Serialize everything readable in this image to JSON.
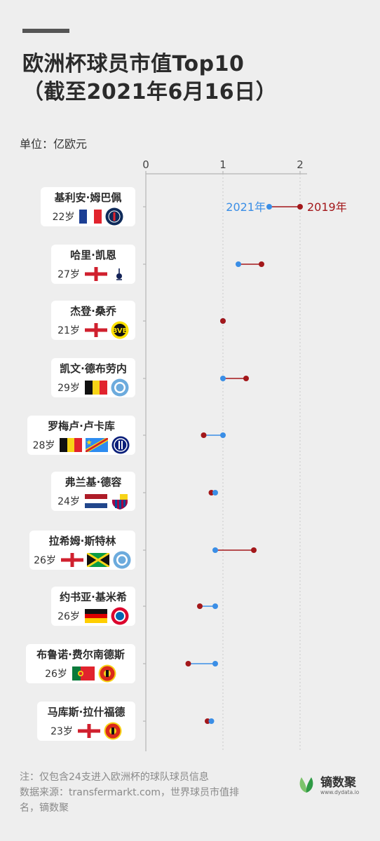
{
  "title_line1": "欧洲杯球员市值Top10",
  "title_line2": "（截至2021年6月16日）",
  "unit_label": "单位：亿欧元",
  "chart_data": {
    "type": "dumbbell",
    "x_ticks": [
      "0",
      "1",
      "2"
    ],
    "xlim": [
      0,
      2
    ],
    "series": [
      {
        "name": "2021年",
        "color": "#3a8ee6",
        "values": [
          1.6,
          1.2,
          1.0,
          1.0,
          1.0,
          0.9,
          0.9,
          0.9,
          0.9,
          0.85
        ]
      },
      {
        "name": "2019年",
        "color": "#a3171a",
        "values": [
          2.0,
          1.5,
          1.0,
          1.3,
          0.75,
          0.85,
          1.4,
          0.7,
          0.55,
          0.8
        ]
      }
    ],
    "players": [
      {
        "name": "基利安·姆巴佩",
        "age": "22岁",
        "flags": [
          "fr"
        ],
        "club": "psg"
      },
      {
        "name": "哈里·凯恩",
        "age": "27岁",
        "flags": [
          "en"
        ],
        "club": "tot"
      },
      {
        "name": "杰登·桑乔",
        "age": "21岁",
        "flags": [
          "en"
        ],
        "club": "bvb"
      },
      {
        "name": "凯文·德布劳内",
        "age": "29岁",
        "flags": [
          "be"
        ],
        "club": "mci"
      },
      {
        "name": "罗梅卢·卢卡库",
        "age": "28岁",
        "flags": [
          "be",
          "cd"
        ],
        "club": "int"
      },
      {
        "name": "弗兰基·德容",
        "age": "24岁",
        "flags": [
          "nl"
        ],
        "club": "fcb"
      },
      {
        "name": "拉希姆·斯特林",
        "age": "26岁",
        "flags": [
          "en",
          "jm"
        ],
        "club": "mci"
      },
      {
        "name": "约书亚·基米希",
        "age": "26岁",
        "flags": [
          "de"
        ],
        "club": "bay"
      },
      {
        "name": "布鲁诺·费尔南德斯",
        "age": "26岁",
        "flags": [
          "pt"
        ],
        "club": "mun"
      },
      {
        "name": "马库斯·拉什福德",
        "age": "23岁",
        "flags": [
          "en"
        ],
        "club": "mun"
      }
    ]
  },
  "footer": {
    "note": "注：仅包含24支进入欧洲杯的球队球员信息",
    "source": "数据来源：transfermarkt.com，世界球员市值排名，镝数聚"
  },
  "brand": {
    "name": "镝数聚",
    "url": "www.dydata.io"
  },
  "colors": {
    "accent_2021": "#3a8ee6",
    "accent_2019": "#a3171a",
    "background": "#eeeeee"
  }
}
